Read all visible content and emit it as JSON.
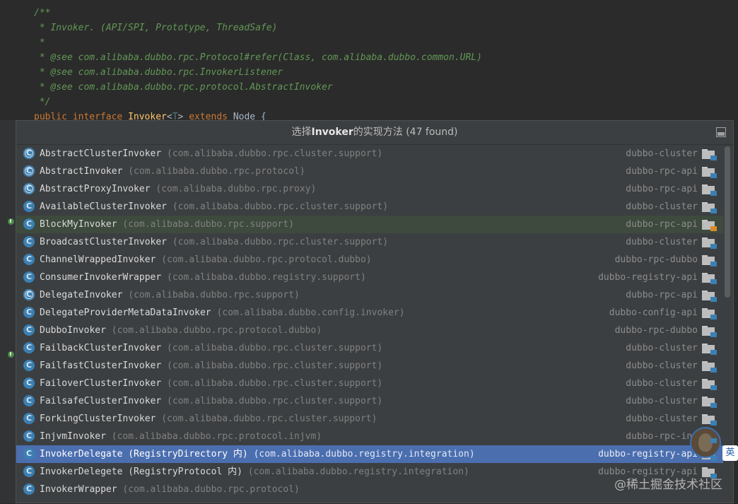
{
  "editor": {
    "lines": [
      "/**",
      " * Invoker. (API/SPI, Prototype, ThreadSafe)",
      " *",
      " * @see com.alibaba.dubbo.rpc.Protocol#refer(Class, com.alibaba.dubbo.common.URL)",
      " * @see com.alibaba.dubbo.rpc.InvokerListener",
      " * @see com.alibaba.dubbo.rpc.protocol.AbstractInvoker",
      " */"
    ],
    "decl": {
      "kw1": "public",
      "kw2": "interface",
      "name": "Invoker",
      "lt": "<",
      "tparam": "T",
      "gt": ">",
      "kw3": "extends",
      "parent": "Node",
      "brace": "{"
    }
  },
  "popup": {
    "title_prefix": "选择",
    "title_highlight": "Invoker",
    "title_suffix": "的实现方法 (47 found)",
    "items": [
      {
        "name": "AbstractClusterInvoker",
        "pkg": "(com.alibaba.dubbo.rpc.cluster.support)",
        "module": "dubbo-cluster",
        "abstract": true
      },
      {
        "name": "AbstractInvoker",
        "pkg": "(com.alibaba.dubbo.rpc.protocol)",
        "module": "dubbo-rpc-api",
        "abstract": true
      },
      {
        "name": "AbstractProxyInvoker",
        "pkg": "(com.alibaba.dubbo.rpc.proxy)",
        "module": "dubbo-rpc-api",
        "abstract": true
      },
      {
        "name": "AvailableClusterInvoker",
        "pkg": "(com.alibaba.dubbo.rpc.cluster.support)",
        "module": "dubbo-cluster",
        "abstract": false
      },
      {
        "name": "BlockMyInvoker",
        "pkg": "(com.alibaba.dubbo.rpc.support)",
        "module": "dubbo-rpc-api",
        "abstract": false,
        "hover": true
      },
      {
        "name": "BroadcastClusterInvoker",
        "pkg": "(com.alibaba.dubbo.rpc.cluster.support)",
        "module": "dubbo-cluster",
        "abstract": false
      },
      {
        "name": "ChannelWrappedInvoker",
        "pkg": "(com.alibaba.dubbo.rpc.protocol.dubbo)",
        "module": "dubbo-rpc-dubbo",
        "abstract": false
      },
      {
        "name": "ConsumerInvokerWrapper",
        "pkg": "(com.alibaba.dubbo.registry.support)",
        "module": "dubbo-registry-api",
        "abstract": false
      },
      {
        "name": "DelegateInvoker",
        "pkg": "(com.alibaba.dubbo.rpc.support)",
        "module": "dubbo-rpc-api",
        "abstract": true
      },
      {
        "name": "DelegateProviderMetaDataInvoker",
        "pkg": "(com.alibaba.dubbo.config.invoker)",
        "module": "dubbo-config-api",
        "abstract": false
      },
      {
        "name": "DubboInvoker",
        "pkg": "(com.alibaba.dubbo.rpc.protocol.dubbo)",
        "module": "dubbo-rpc-dubbo",
        "abstract": false
      },
      {
        "name": "FailbackClusterInvoker",
        "pkg": "(com.alibaba.dubbo.rpc.cluster.support)",
        "module": "dubbo-cluster",
        "abstract": false
      },
      {
        "name": "FailfastClusterInvoker",
        "pkg": "(com.alibaba.dubbo.rpc.cluster.support)",
        "module": "dubbo-cluster",
        "abstract": false
      },
      {
        "name": "FailoverClusterInvoker",
        "pkg": "(com.alibaba.dubbo.rpc.cluster.support)",
        "module": "dubbo-cluster",
        "abstract": false
      },
      {
        "name": "FailsafeClusterInvoker",
        "pkg": "(com.alibaba.dubbo.rpc.cluster.support)",
        "module": "dubbo-cluster",
        "abstract": false
      },
      {
        "name": "ForkingClusterInvoker",
        "pkg": "(com.alibaba.dubbo.rpc.cluster.support)",
        "module": "dubbo-cluster",
        "abstract": false
      },
      {
        "name": "InjvmInvoker",
        "pkg": "(com.alibaba.dubbo.rpc.protocol.injvm)",
        "module": "dubbo-rpc-inj",
        "abstract": false
      },
      {
        "name": "InvokerDelegate (RegistryDirectory 内)",
        "pkg": "(com.alibaba.dubbo.registry.integration)",
        "module": "dubbo-registry-api",
        "abstract": false,
        "selected": true
      },
      {
        "name": "InvokerDelegete (RegistryProtocol 内)",
        "pkg": "(com.alibaba.dubbo.registry.integration)",
        "module": "dubbo-registry-api",
        "abstract": false
      },
      {
        "name": "InvokerWrapper",
        "pkg": "(com.alibaba.dubbo.rpc.protocol)",
        "module": "",
        "abstract": false
      }
    ]
  },
  "overlay": {
    "watermark": "@稀土掘金技术社区",
    "ime_label": "英"
  },
  "colors": {
    "selection": "#4b6eaf",
    "class_icon": "#3b80b3",
    "doc_comment": "#629755",
    "keyword": "#cc7832"
  }
}
